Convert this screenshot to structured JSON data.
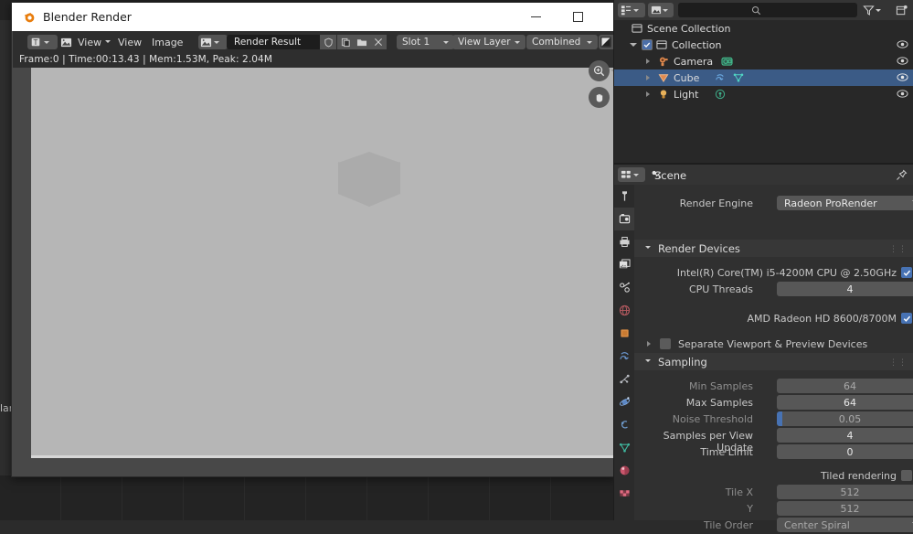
{
  "window": {
    "title": "Blender Render",
    "icon": "blender-logo-icon",
    "minimize_label": "—",
    "maximize_label": "□",
    "close_label": "✕"
  },
  "image_editor_header": {
    "editor_type_icon": "image-editor-type-icon",
    "mode_icon": "image-mode-icon",
    "menus": [
      "View",
      "View",
      "Image"
    ],
    "datablock_icon": "image-datablock-icon",
    "datablock_name": "Render Result",
    "fake_user_icon": "shield-icon",
    "new_image_icon": "copy-icon",
    "open_image_icon": "folder-icon",
    "unlink_icon": "close-x-icon",
    "slot": "Slot 1",
    "view_layer": "View Layer",
    "pass": "Combined",
    "display_channels_icon": "color-channels-icon"
  },
  "render_status": {
    "text": "Frame:0 | Time:00:13.43 | Mem:1.53M, Peak: 2.04M",
    "frame": "0",
    "time": "00:13.43",
    "memory": "1.53M",
    "peak": "2.04M"
  },
  "viewport_tools": {
    "zoom_icon": "zoom-in-icon",
    "pan_icon": "hand-pan-icon"
  },
  "desktop": {
    "side_label": "lar"
  },
  "outliner": {
    "display_mode_icon": "outliner-display-mode-icon",
    "filter_id_icon": "id-type-filter-icon",
    "search_placeholder": "",
    "filter_icon": "funnel-filter-icon",
    "new_collection_icon": "new-collection-icon",
    "rows": [
      {
        "label": "Scene Collection",
        "icon": "scene-collection-icon",
        "indent": 20,
        "selected": false,
        "disclosure": "none",
        "checkbox": false,
        "eye": false
      },
      {
        "label": "Collection",
        "icon": "collection-icon",
        "indent": 36,
        "selected": false,
        "disclosure": "open",
        "checkbox": true,
        "eye": true
      },
      {
        "label": "Camera",
        "icon": "camera-icon",
        "indent": 54,
        "selected": false,
        "disclosure": "closed",
        "checkbox": false,
        "eye": true,
        "data_icon": "camera-data-icon"
      },
      {
        "label": "Cube",
        "icon": "mesh-icon",
        "indent": 54,
        "selected": true,
        "disclosure": "closed",
        "checkbox": false,
        "eye": true,
        "data_icon": "modifier-and-mesh-data-icon"
      },
      {
        "label": "Light",
        "icon": "light-icon",
        "indent": 54,
        "selected": false,
        "disclosure": "closed",
        "checkbox": false,
        "eye": true,
        "data_icon": "light-data-icon"
      }
    ]
  },
  "properties": {
    "header_title": "Scene",
    "header_browse_icon": "properties-browse-icon",
    "header_scene_icon": "scene-icon",
    "pin_icon": "pin-icon",
    "tabs": [
      {
        "name": "tool",
        "icon": "tool-wrench-icon",
        "active": false
      },
      {
        "name": "render",
        "icon": "render-camera-back-icon",
        "active": true
      },
      {
        "name": "output",
        "icon": "output-printer-icon",
        "active": false
      },
      {
        "name": "view-layer",
        "icon": "view-layer-images-icon",
        "active": false
      },
      {
        "name": "scene",
        "icon": "scene-cone-icon",
        "active": false
      },
      {
        "name": "world",
        "icon": "world-globe-icon",
        "active": false
      },
      {
        "name": "object",
        "icon": "object-square-icon",
        "active": false
      },
      {
        "name": "modifiers",
        "icon": "modifier-wrench-icon",
        "active": false
      },
      {
        "name": "particles",
        "icon": "particles-icon",
        "active": false
      },
      {
        "name": "physics",
        "icon": "physics-orbit-icon",
        "active": false
      },
      {
        "name": "constraints",
        "icon": "constraints-icon",
        "active": false
      },
      {
        "name": "data",
        "icon": "mesh-data-triangle-icon",
        "active": false
      },
      {
        "name": "material",
        "icon": "material-sphere-icon",
        "active": false
      },
      {
        "name": "texture",
        "icon": "texture-checker-icon",
        "active": false
      }
    ],
    "render_engine": {
      "label": "Render Engine",
      "value": "Radeon ProRender"
    },
    "render_devices": {
      "section_title": "Render Devices",
      "cpu_device": {
        "label": "Intel(R) Core(TM) i5-4200M CPU @ 2.50GHz",
        "checked": true
      },
      "cpu_threads": {
        "label": "CPU Threads",
        "value": "4"
      },
      "gpu_device": {
        "label": "AMD Radeon HD 8600/8700M",
        "checked": true
      },
      "separate_viewport": {
        "label": "Separate Viewport & Preview Devices",
        "checked": false
      }
    },
    "sampling": {
      "section_title": "Sampling",
      "fields": [
        {
          "label": "Min Samples",
          "value": "64",
          "dim": true,
          "type": "number"
        },
        {
          "label": "Max Samples",
          "value": "64",
          "dim": false,
          "type": "number"
        },
        {
          "label": "Noise Threshold",
          "value": "0.05",
          "dim": true,
          "type": "slider"
        },
        {
          "label": "Samples per View Update",
          "value": "4",
          "dim": false,
          "type": "number"
        },
        {
          "label": "Time Limit",
          "value": "0",
          "dim": false,
          "type": "number"
        }
      ],
      "tiled_rendering": {
        "label": "Tiled rendering",
        "checked": false
      },
      "tile_x": {
        "label": "Tile X",
        "value": "512",
        "dim": true
      },
      "tile_y": {
        "label": "Y",
        "value": "512",
        "dim": true
      },
      "tile_order": {
        "label": "Tile Order",
        "value": "Center Spiral",
        "dim": true
      }
    }
  },
  "colors": {
    "accent_blue": "#4772b3",
    "selection_blue": "#3b5b86",
    "panel_bg": "#303030",
    "field_bg": "#575757",
    "canvas_grey": "#b6b6b6"
  }
}
